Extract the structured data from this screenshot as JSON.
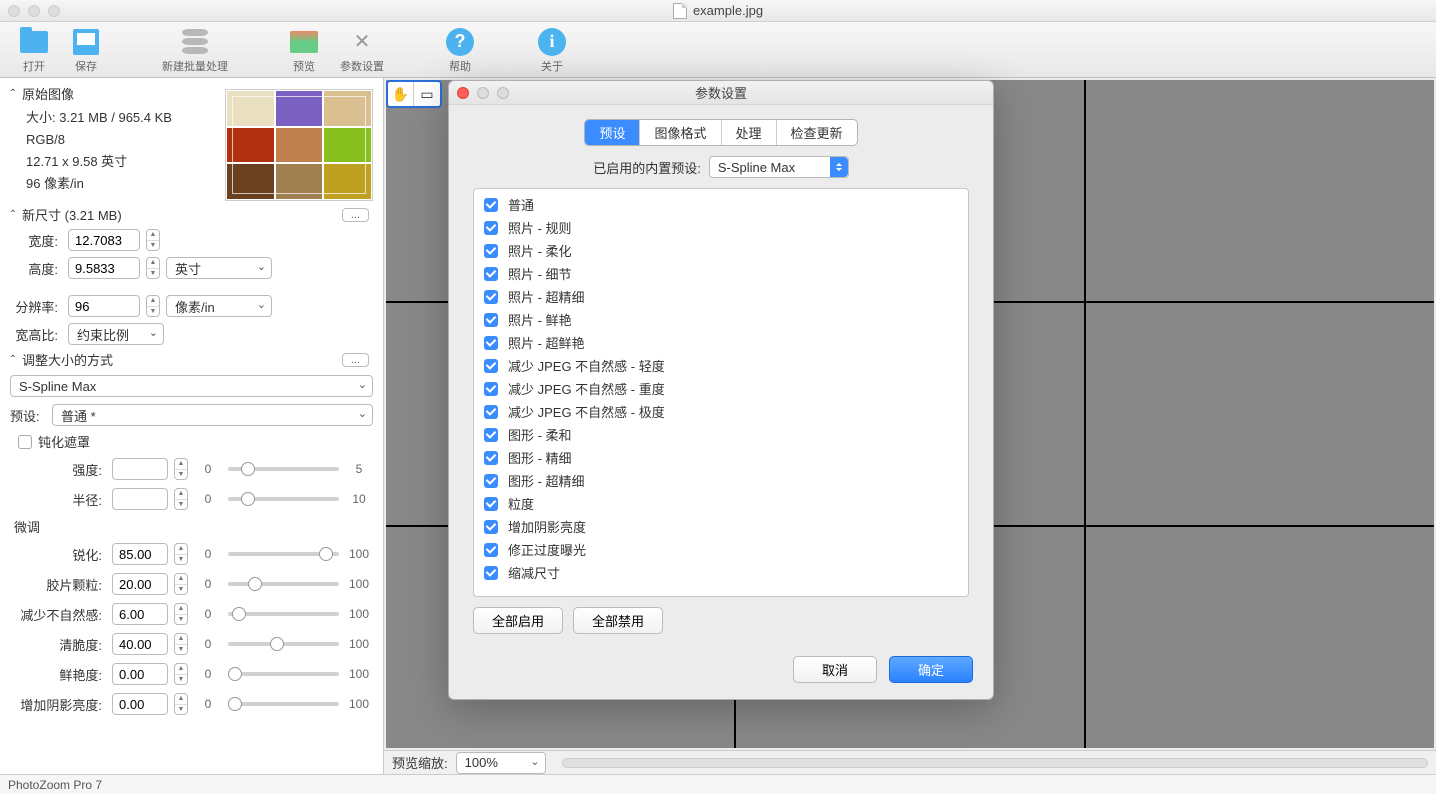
{
  "window": {
    "title": "example.jpg"
  },
  "toolbar": {
    "open": "打开",
    "save": "保存",
    "batch": "新建批量处理",
    "preview": "预览",
    "prefs": "参数设置",
    "help": "帮助",
    "about": "关于"
  },
  "left": {
    "section_original": "原始图像",
    "size_line": "大小: 3.21 MB / 965.4 KB",
    "mode": "RGB/8",
    "dim_inch": "12.71 x 9.58 英寸",
    "dpi": "96 像素/in",
    "section_newsize": "新尺寸 (3.21 MB)",
    "more_btn": "...",
    "width_lbl": "宽度:",
    "width_val": "12.7083",
    "height_lbl": "高度:",
    "height_val": "9.5833",
    "unit_select": "英寸",
    "res_lbl": "分辨率:",
    "res_val": "96",
    "res_unit": "像素/in",
    "ratio_lbl": "宽高比:",
    "ratio_val": "约束比例",
    "section_resize": "调整大小的方式",
    "method": "S-Spline Max",
    "preset_lbl": "预设:",
    "preset_val": "普通 *",
    "unsharp_lbl": "钝化遮罩",
    "intensity_lbl": "强度:",
    "intensity_min": "0",
    "intensity_max": "5",
    "radius_lbl": "半径:",
    "radius_min": "0",
    "radius_max": "10",
    "finetune_header": "微调",
    "sharpen_lbl": "锐化:",
    "sharpen_val": "85.00",
    "grain_lbl": "胶片颗粒:",
    "grain_val": "20.00",
    "artifact_lbl": "减少不自然感:",
    "artifact_val": "6.00",
    "crisp_lbl": "清脆度:",
    "crisp_val": "40.00",
    "vivid_lbl": "鲜艳度:",
    "vivid_val": "0.00",
    "shadow_lbl": "增加阴影亮度:",
    "shadow_val": "0.00",
    "min0": "0",
    "max100": "100"
  },
  "preview": {
    "zoom_lbl": "预览缩放:",
    "zoom_val": "100%"
  },
  "modal": {
    "title": "参数设置",
    "tabs": [
      "预设",
      "图像格式",
      "处理",
      "检查更新"
    ],
    "sub_lbl": "已启用的内置预设:",
    "sub_select": "S-Spline Max",
    "items": [
      "普通",
      "照片 - 规则",
      "照片 - 柔化",
      "照片 - 细节",
      "照片 - 超精细",
      "照片 - 鲜艳",
      "照片 - 超鲜艳",
      "减少 JPEG 不自然感 - 轻度",
      "减少 JPEG 不自然感 - 重度",
      "减少 JPEG 不自然感 - 极度",
      "图形 - 柔和",
      "图形 - 精细",
      "图形 - 超精细",
      "粒度",
      "增加阴影亮度",
      "修正过度曝光",
      "缩减尺寸"
    ],
    "enable_all": "全部启用",
    "disable_all": "全部禁用",
    "cancel": "取消",
    "ok": "确定"
  },
  "status": {
    "app": "PhotoZoom Pro 7"
  }
}
